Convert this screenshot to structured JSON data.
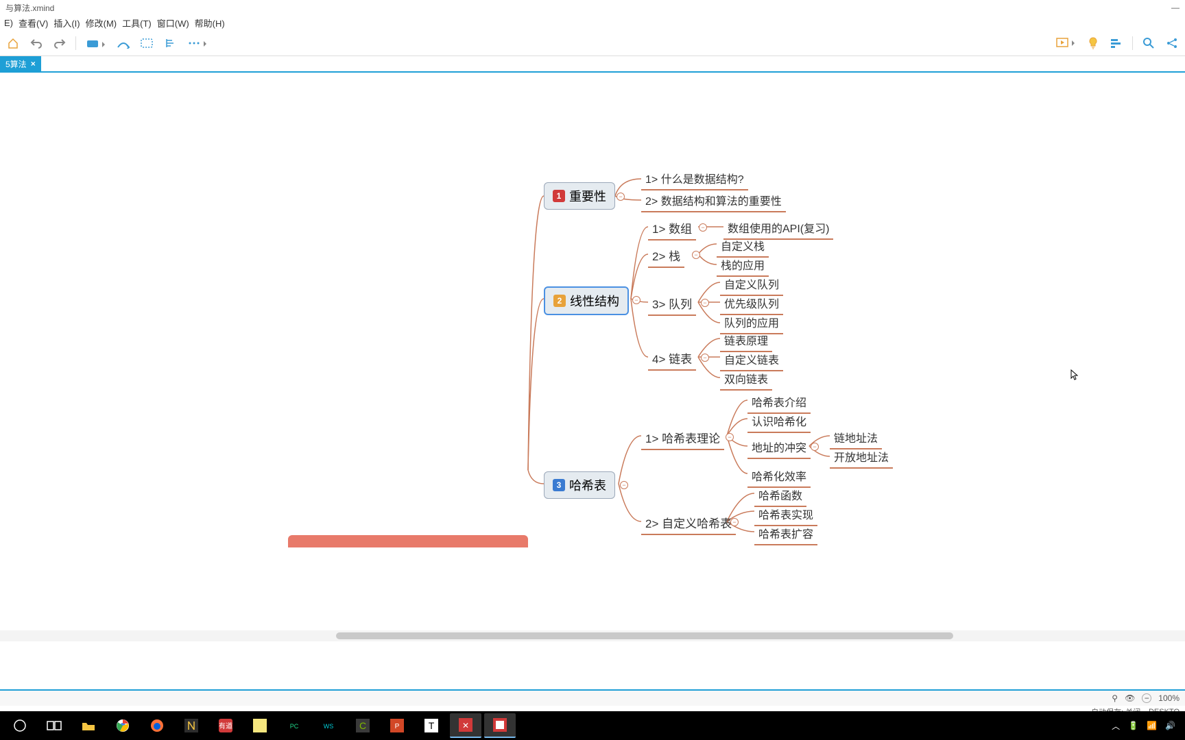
{
  "window": {
    "title": "与算法.xmind",
    "minimize": "—"
  },
  "menu": {
    "edit": "E)",
    "view": "查看(V)",
    "insert": "插入(I)",
    "modify": "修改(M)",
    "tools": "工具(T)",
    "window": "窗口(W)",
    "help": "帮助(H)"
  },
  "tab": {
    "label": "5算法",
    "close": "×"
  },
  "mindmap": {
    "topics": [
      {
        "id": "t1",
        "badge": "1",
        "label": "重要性",
        "children": [
          {
            "label": "1> 什么是数据结构?"
          },
          {
            "label": "2> 数据结构和算法的重要性"
          }
        ]
      },
      {
        "id": "t2",
        "badge": "2",
        "label": "线性结构",
        "children": [
          {
            "label": "1> 数组",
            "children": [
              {
                "label": "数组使用的API(复习)"
              }
            ]
          },
          {
            "label": "2> 栈",
            "children": [
              {
                "label": "自定义栈"
              },
              {
                "label": "栈的应用"
              }
            ]
          },
          {
            "label": "3> 队列",
            "children": [
              {
                "label": "自定义队列"
              },
              {
                "label": "优先级队列"
              },
              {
                "label": "队列的应用"
              }
            ]
          },
          {
            "label": "4> 链表",
            "children": [
              {
                "label": "链表原理"
              },
              {
                "label": "自定义链表"
              },
              {
                "label": "双向链表"
              }
            ]
          }
        ]
      },
      {
        "id": "t3",
        "badge": "3",
        "label": "哈希表",
        "children": [
          {
            "label": "1> 哈希表理论",
            "children": [
              {
                "label": "哈希表介绍"
              },
              {
                "label": "认识哈希化"
              },
              {
                "label": "地址的冲突",
                "children": [
                  {
                    "label": "链地址法"
                  },
                  {
                    "label": "开放地址法"
                  }
                ]
              },
              {
                "label": "哈希化效率"
              }
            ]
          },
          {
            "label": "2> 自定义哈希表",
            "children": [
              {
                "label": "哈希函数"
              },
              {
                "label": "哈希表实现"
              },
              {
                "label": "哈希表扩容"
              }
            ]
          }
        ]
      }
    ]
  },
  "status": {
    "zoom": "100%",
    "zminus": "−",
    "filter": "⚲",
    "eye": "👁",
    "autosave": "自动保存: 关闭",
    "desktop": "DESKTO"
  }
}
